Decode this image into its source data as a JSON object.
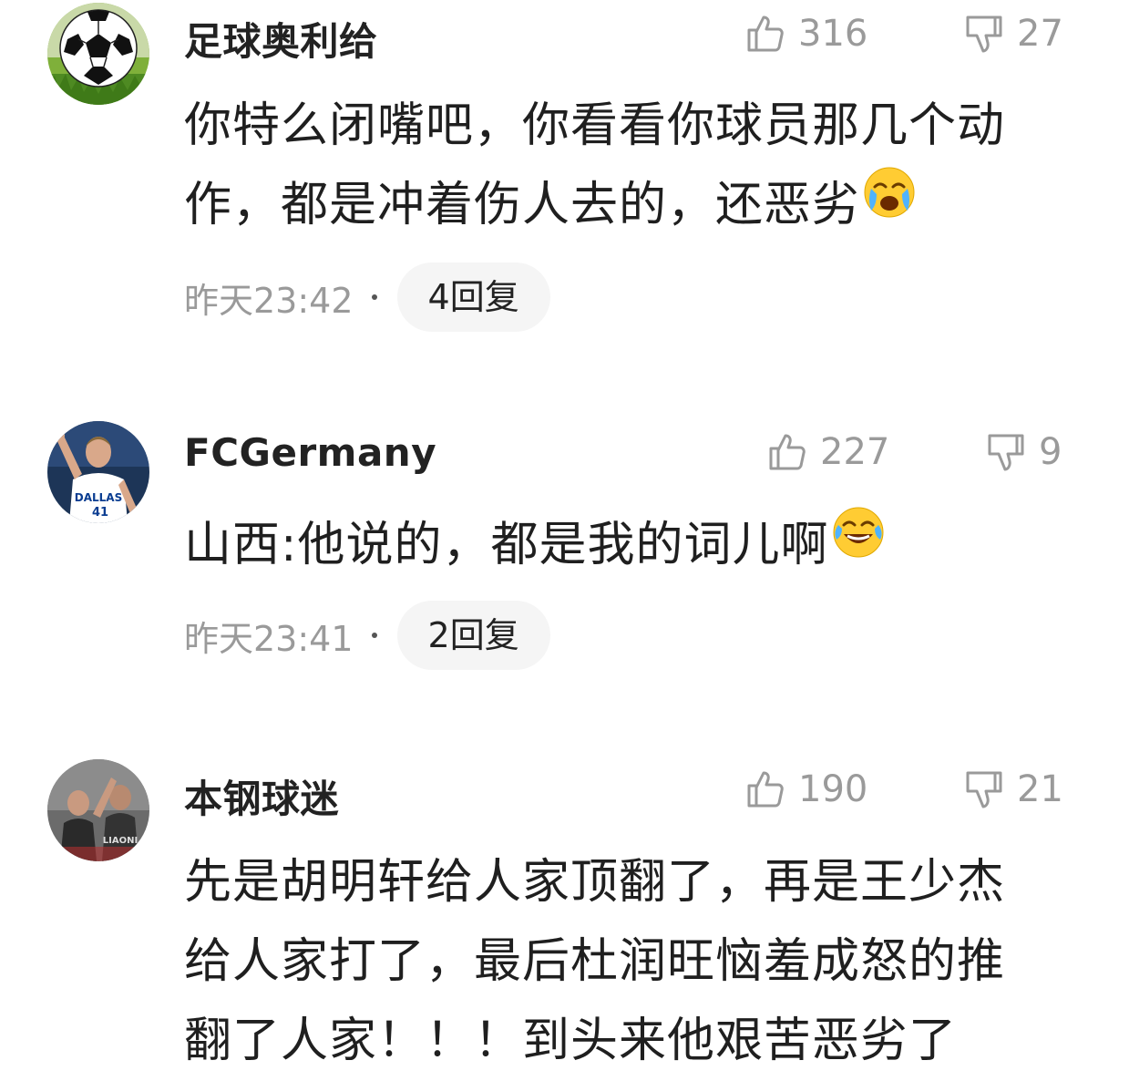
{
  "comments": [
    {
      "username": "足球奥利给",
      "likes": "316",
      "dislikes": "27",
      "lines": [
        "你特么闭嘴吧，你看看你球员那几个动",
        "作，都是冲着伤人去的，还恶劣"
      ],
      "emoji": "crying-face",
      "time": "昨天23:42",
      "replies": "4回复"
    },
    {
      "username": "FCGermany",
      "likes": "227",
      "dislikes": "9",
      "lines": [
        "山西:他说的，都是我的词儿啊"
      ],
      "emoji": "laughing-tears-face",
      "time": "昨天23:41",
      "replies": "2回复",
      "avatar_text": [
        "DALLAS",
        "41"
      ]
    },
    {
      "username": "本钢球迷",
      "likes": "190",
      "dislikes": "21",
      "lines": [
        "先是胡明轩给人家顶翻了，再是王少杰",
        "给人家打了，最后杜润旺恼羞成怒的推",
        "翻了人家！！！到头来他艰苦恶劣了"
      ],
      "avatar_text": [
        "LIAONI"
      ]
    }
  ]
}
